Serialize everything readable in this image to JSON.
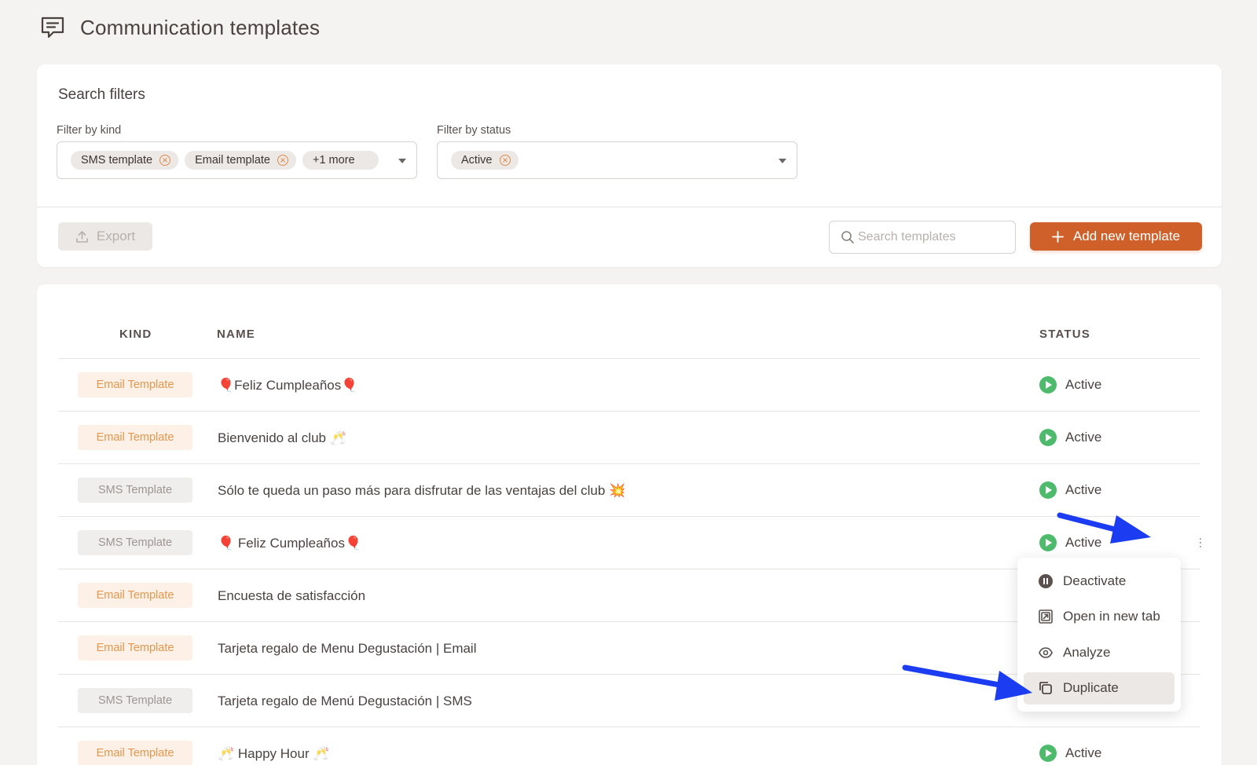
{
  "page": {
    "title": "Communication templates",
    "icon": "chat-bubble-icon"
  },
  "filters": {
    "title": "Search filters",
    "kind": {
      "label": "Filter by kind",
      "chips": [
        "SMS template",
        "Email template"
      ],
      "more": "+1 more"
    },
    "status": {
      "label": "Filter by status",
      "chips": [
        "Active"
      ]
    }
  },
  "toolbar": {
    "export_label": "Export",
    "search_placeholder": "Search templates",
    "add_label": "Add new template"
  },
  "table": {
    "headers": {
      "kind": "KIND",
      "name": "NAME",
      "status": "STATUS"
    },
    "rows": [
      {
        "kind": "Email Template",
        "kind_type": "email",
        "name": "🎈Feliz Cumpleaños🎈",
        "status": "Active"
      },
      {
        "kind": "Email Template",
        "kind_type": "email",
        "name": "Bienvenido al club 🥂",
        "status": "Active"
      },
      {
        "kind": "SMS Template",
        "kind_type": "sms",
        "name": "Sólo te queda un paso más para disfrutar de las ventajas del club 💥",
        "status": "Active"
      },
      {
        "kind": "SMS Template",
        "kind_type": "sms",
        "name": "🎈 Feliz Cumpleaños🎈",
        "status": "Active"
      },
      {
        "kind": "Email Template",
        "kind_type": "email",
        "name": "Encuesta de satisfacción",
        "status": ""
      },
      {
        "kind": "Email Template",
        "kind_type": "email",
        "name": "Tarjeta regalo de Menu Degustación | Email",
        "status": ""
      },
      {
        "kind": "SMS Template",
        "kind_type": "sms",
        "name": "Tarjeta regalo de Menú Degustación | SMS",
        "status": ""
      },
      {
        "kind": "Email Template",
        "kind_type": "email",
        "name": "🥂 Happy Hour 🥂",
        "status": "Active"
      }
    ]
  },
  "context_menu": {
    "items": [
      {
        "label": "Deactivate",
        "icon": "pause-circle-icon"
      },
      {
        "label": "Open in new tab",
        "icon": "external-link-icon"
      },
      {
        "label": "Analyze",
        "icon": "eye-icon"
      },
      {
        "label": "Duplicate",
        "icon": "copy-icon"
      }
    ]
  },
  "colors": {
    "accent": "#d0602a",
    "active_green": "#4dbb6b",
    "annotation_arrow": "#1b3cf0"
  }
}
